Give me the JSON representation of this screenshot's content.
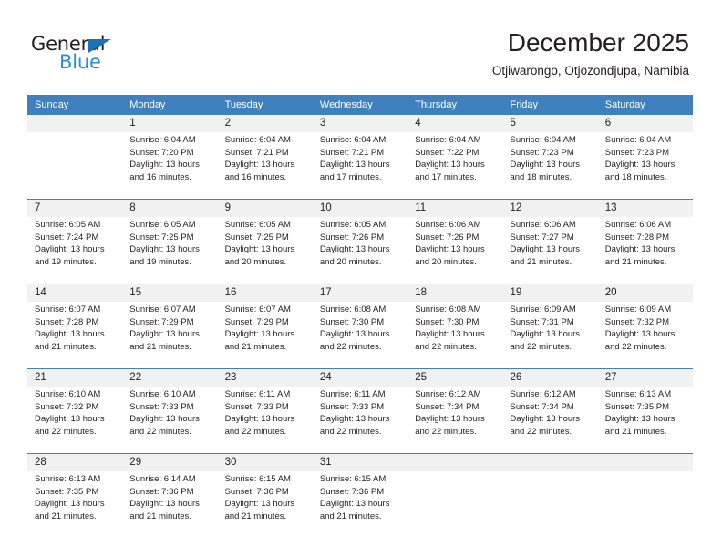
{
  "brand": {
    "name_part1": "General",
    "name_part2": "Blue"
  },
  "header": {
    "title": "December 2025",
    "subtitle": "Otjiwarongo, Otjozondjupa, Namibia"
  },
  "colors": {
    "header_blue": "#3f80bf",
    "brand_blue": "#2b8ed6",
    "triangle_blue": "#1f6fb4",
    "daynum_bg": "#f1f1f1",
    "text": "#231f20"
  },
  "weekdays": [
    "Sunday",
    "Monday",
    "Tuesday",
    "Wednesday",
    "Thursday",
    "Friday",
    "Saturday"
  ],
  "weeks": [
    [
      {
        "day": "",
        "lines": []
      },
      {
        "day": "1",
        "lines": [
          "Sunrise: 6:04 AM",
          "Sunset: 7:20 PM",
          "Daylight: 13 hours",
          "and 16 minutes."
        ]
      },
      {
        "day": "2",
        "lines": [
          "Sunrise: 6:04 AM",
          "Sunset: 7:21 PM",
          "Daylight: 13 hours",
          "and 16 minutes."
        ]
      },
      {
        "day": "3",
        "lines": [
          "Sunrise: 6:04 AM",
          "Sunset: 7:21 PM",
          "Daylight: 13 hours",
          "and 17 minutes."
        ]
      },
      {
        "day": "4",
        "lines": [
          "Sunrise: 6:04 AM",
          "Sunset: 7:22 PM",
          "Daylight: 13 hours",
          "and 17 minutes."
        ]
      },
      {
        "day": "5",
        "lines": [
          "Sunrise: 6:04 AM",
          "Sunset: 7:23 PM",
          "Daylight: 13 hours",
          "and 18 minutes."
        ]
      },
      {
        "day": "6",
        "lines": [
          "Sunrise: 6:04 AM",
          "Sunset: 7:23 PM",
          "Daylight: 13 hours",
          "and 18 minutes."
        ]
      }
    ],
    [
      {
        "day": "7",
        "lines": [
          "Sunrise: 6:05 AM",
          "Sunset: 7:24 PM",
          "Daylight: 13 hours",
          "and 19 minutes."
        ]
      },
      {
        "day": "8",
        "lines": [
          "Sunrise: 6:05 AM",
          "Sunset: 7:25 PM",
          "Daylight: 13 hours",
          "and 19 minutes."
        ]
      },
      {
        "day": "9",
        "lines": [
          "Sunrise: 6:05 AM",
          "Sunset: 7:25 PM",
          "Daylight: 13 hours",
          "and 20 minutes."
        ]
      },
      {
        "day": "10",
        "lines": [
          "Sunrise: 6:05 AM",
          "Sunset: 7:26 PM",
          "Daylight: 13 hours",
          "and 20 minutes."
        ]
      },
      {
        "day": "11",
        "lines": [
          "Sunrise: 6:06 AM",
          "Sunset: 7:26 PM",
          "Daylight: 13 hours",
          "and 20 minutes."
        ]
      },
      {
        "day": "12",
        "lines": [
          "Sunrise: 6:06 AM",
          "Sunset: 7:27 PM",
          "Daylight: 13 hours",
          "and 21 minutes."
        ]
      },
      {
        "day": "13",
        "lines": [
          "Sunrise: 6:06 AM",
          "Sunset: 7:28 PM",
          "Daylight: 13 hours",
          "and 21 minutes."
        ]
      }
    ],
    [
      {
        "day": "14",
        "lines": [
          "Sunrise: 6:07 AM",
          "Sunset: 7:28 PM",
          "Daylight: 13 hours",
          "and 21 minutes."
        ]
      },
      {
        "day": "15",
        "lines": [
          "Sunrise: 6:07 AM",
          "Sunset: 7:29 PM",
          "Daylight: 13 hours",
          "and 21 minutes."
        ]
      },
      {
        "day": "16",
        "lines": [
          "Sunrise: 6:07 AM",
          "Sunset: 7:29 PM",
          "Daylight: 13 hours",
          "and 21 minutes."
        ]
      },
      {
        "day": "17",
        "lines": [
          "Sunrise: 6:08 AM",
          "Sunset: 7:30 PM",
          "Daylight: 13 hours",
          "and 22 minutes."
        ]
      },
      {
        "day": "18",
        "lines": [
          "Sunrise: 6:08 AM",
          "Sunset: 7:30 PM",
          "Daylight: 13 hours",
          "and 22 minutes."
        ]
      },
      {
        "day": "19",
        "lines": [
          "Sunrise: 6:09 AM",
          "Sunset: 7:31 PM",
          "Daylight: 13 hours",
          "and 22 minutes."
        ]
      },
      {
        "day": "20",
        "lines": [
          "Sunrise: 6:09 AM",
          "Sunset: 7:32 PM",
          "Daylight: 13 hours",
          "and 22 minutes."
        ]
      }
    ],
    [
      {
        "day": "21",
        "lines": [
          "Sunrise: 6:10 AM",
          "Sunset: 7:32 PM",
          "Daylight: 13 hours",
          "and 22 minutes."
        ]
      },
      {
        "day": "22",
        "lines": [
          "Sunrise: 6:10 AM",
          "Sunset: 7:33 PM",
          "Daylight: 13 hours",
          "and 22 minutes."
        ]
      },
      {
        "day": "23",
        "lines": [
          "Sunrise: 6:11 AM",
          "Sunset: 7:33 PM",
          "Daylight: 13 hours",
          "and 22 minutes."
        ]
      },
      {
        "day": "24",
        "lines": [
          "Sunrise: 6:11 AM",
          "Sunset: 7:33 PM",
          "Daylight: 13 hours",
          "and 22 minutes."
        ]
      },
      {
        "day": "25",
        "lines": [
          "Sunrise: 6:12 AM",
          "Sunset: 7:34 PM",
          "Daylight: 13 hours",
          "and 22 minutes."
        ]
      },
      {
        "day": "26",
        "lines": [
          "Sunrise: 6:12 AM",
          "Sunset: 7:34 PM",
          "Daylight: 13 hours",
          "and 22 minutes."
        ]
      },
      {
        "day": "27",
        "lines": [
          "Sunrise: 6:13 AM",
          "Sunset: 7:35 PM",
          "Daylight: 13 hours",
          "and 21 minutes."
        ]
      }
    ],
    [
      {
        "day": "28",
        "lines": [
          "Sunrise: 6:13 AM",
          "Sunset: 7:35 PM",
          "Daylight: 13 hours",
          "and 21 minutes."
        ]
      },
      {
        "day": "29",
        "lines": [
          "Sunrise: 6:14 AM",
          "Sunset: 7:36 PM",
          "Daylight: 13 hours",
          "and 21 minutes."
        ]
      },
      {
        "day": "30",
        "lines": [
          "Sunrise: 6:15 AM",
          "Sunset: 7:36 PM",
          "Daylight: 13 hours",
          "and 21 minutes."
        ]
      },
      {
        "day": "31",
        "lines": [
          "Sunrise: 6:15 AM",
          "Sunset: 7:36 PM",
          "Daylight: 13 hours",
          "and 21 minutes."
        ]
      },
      {
        "day": "",
        "lines": []
      },
      {
        "day": "",
        "lines": []
      },
      {
        "day": "",
        "lines": []
      }
    ]
  ]
}
